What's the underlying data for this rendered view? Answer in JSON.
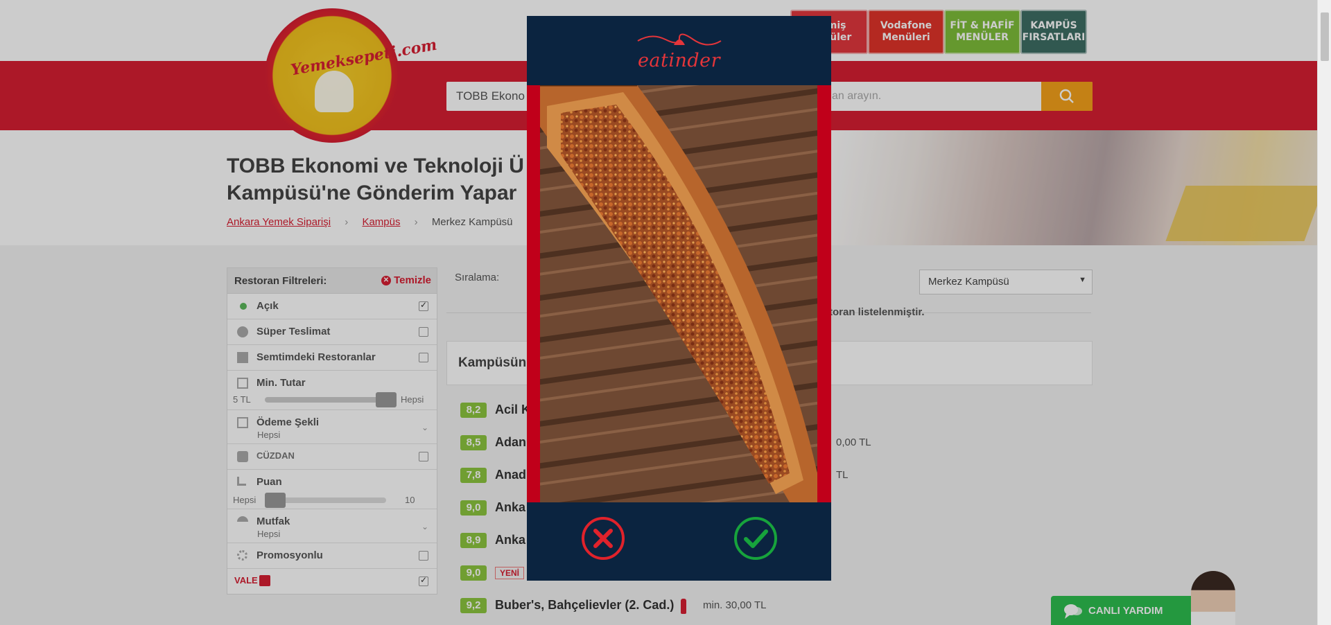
{
  "header": {
    "logo_text": "Yemeksepeti.com",
    "promos": [
      {
        "label": "Hemiş Menüler",
        "color": "#e3383e"
      },
      {
        "label": "Vodafone Menüleri",
        "color": "#e2342a"
      },
      {
        "label": "FİT & HAFİF MENÜLER",
        "color": "#7fbf3a"
      },
      {
        "label": "KAMPÜS FIRSATLARI",
        "color": "#3e6e64"
      }
    ],
    "search_value": "TOBB Ekono",
    "search_placeholder_tail": "an arayın."
  },
  "page": {
    "title_line1": "TOBB Ekonomi ve Teknoloji Ü",
    "title_line2": "Kampüsü'ne Gönderim Yapar",
    "breadcrumbs": [
      "Ankara Yemek Siparişi",
      "Kampüs",
      "Merkez Kampüsü"
    ],
    "breadcrumb_sep": "›"
  },
  "filters": {
    "title": "Restoran Filtreleri:",
    "clear": "Temizle",
    "items": [
      {
        "label": "Açık",
        "checked": true
      },
      {
        "label": "Süper Teslimat",
        "checked": false
      },
      {
        "label": "Semtimdeki Restoranlar",
        "checked": false
      },
      {
        "label": "Min. Tutar"
      },
      {
        "label": "Ödeme Şekli",
        "sub": "Hepsi"
      },
      {
        "label": "CÜZDAN",
        "checked": false
      },
      {
        "label": "Puan"
      },
      {
        "label": "Mutfak",
        "sub": "Hepsi"
      },
      {
        "label": "Promosyonlu",
        "checked": false
      },
      {
        "label": "VALE",
        "checked": true
      }
    ],
    "min_tutar": {
      "min_label": "5 TL",
      "max_label": "Hepsi",
      "value_fraction": 1.0
    },
    "puan": {
      "min_label": "Hepsi",
      "max_label": "10",
      "value_fraction": 0.0
    }
  },
  "main": {
    "sort_label": "Sıralama:",
    "campus_select": "Merkez Kampüsü",
    "list_count_tail": "toran listelenmiştir.",
    "campus_header": "Kampüsün",
    "restaurants": [
      {
        "score": "8,2",
        "name": "Acil K",
        "min": ""
      },
      {
        "score": "8,5",
        "name": "Adan",
        "min": "0,00 TL"
      },
      {
        "score": "7,8",
        "name": "Anad",
        "min": "TL"
      },
      {
        "score": "9,0",
        "name": "Anka",
        "min": ""
      },
      {
        "score": "8,9",
        "name": "Anka",
        "min": ""
      },
      {
        "score": "9,0",
        "name": "",
        "badge": "YENİ",
        "min": ""
      },
      {
        "score": "9,2",
        "name": "Buber's, Bahçelievler (2. Cad.)",
        "min": "min. 30,00 TL"
      }
    ]
  },
  "live_help": "CANLI YARDIM",
  "modal": {
    "brand": "eatinder",
    "reject_icon": "close-icon",
    "accept_icon": "check-icon"
  }
}
